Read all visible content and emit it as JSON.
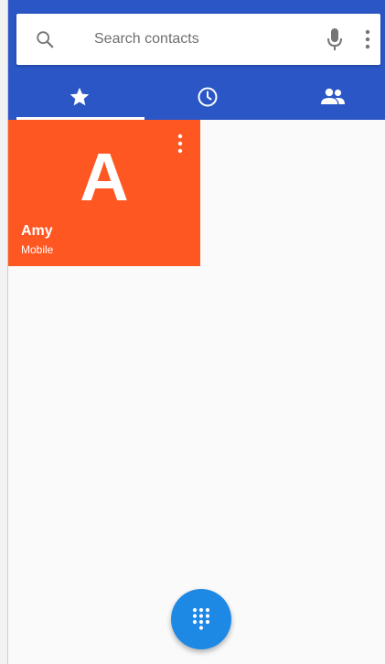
{
  "search": {
    "placeholder": "Search contacts",
    "icons": [
      "search-icon",
      "mic-icon",
      "more-vert-icon"
    ]
  },
  "tabs": [
    {
      "name": "favorites",
      "icon": "star-icon",
      "selected": true
    },
    {
      "name": "recents",
      "icon": "clock-icon",
      "selected": false
    },
    {
      "name": "contacts",
      "icon": "people-icon",
      "selected": false
    }
  ],
  "favorites": [
    {
      "letter": "A",
      "name": "Amy",
      "type": "Mobile",
      "color": "#ff5722"
    }
  ],
  "fab": {
    "icon": "dialpad-icon"
  },
  "colors": {
    "header": "#2a56c6",
    "fab": "#1e88e5",
    "tile": "#ff5722",
    "background": "#fafafa"
  }
}
